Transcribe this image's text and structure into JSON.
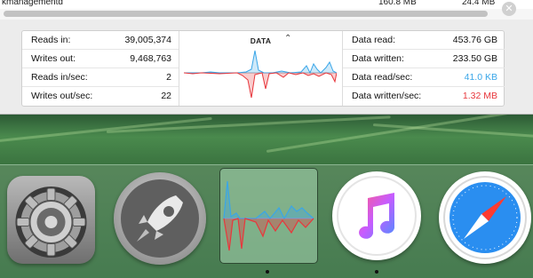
{
  "process_row": {
    "name": "kmanagementd",
    "memory": "160.8 MB",
    "real_memory": "24.4 MB"
  },
  "stats": {
    "left": [
      {
        "label": "Reads in:",
        "value": "39,005,374"
      },
      {
        "label": "Writes out:",
        "value": "9,468,763"
      },
      {
        "label": "Reads in/sec:",
        "value": "2"
      },
      {
        "label": "Writes out/sec:",
        "value": "22"
      }
    ],
    "right": [
      {
        "label": "Data read:",
        "value": "453.76 GB"
      },
      {
        "label": "Data written:",
        "value": "233.50 GB"
      },
      {
        "label": "Data read/sec:",
        "value": "41.0 KB"
      },
      {
        "label": "Data written/sec:",
        "value": "1.32 MB"
      }
    ]
  },
  "graph": {
    "title": "DATA",
    "read_color": "#3aa6e8",
    "write_color": "#e8373c"
  },
  "dock": {
    "items": [
      {
        "name": "System Preferences",
        "icon": "gear-icon"
      },
      {
        "name": "Launchpad",
        "icon": "rocket-icon"
      },
      {
        "name": "Activity Monitor",
        "icon": "activity-graph-icon"
      },
      {
        "name": "iTunes",
        "icon": "music-note-icon"
      },
      {
        "name": "Safari",
        "icon": "compass-icon"
      }
    ]
  }
}
